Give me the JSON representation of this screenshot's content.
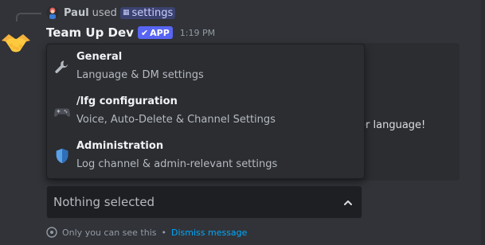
{
  "reply": {
    "user": "Paul",
    "verb": "used",
    "command": "settings"
  },
  "message": {
    "username": "Team Up Dev",
    "badge": "APP",
    "timestamp": "1:19 PM"
  },
  "embed": {
    "visible_text": "rver language!"
  },
  "dropdown": {
    "options": [
      {
        "icon": "wrench-icon",
        "label": "General",
        "description": "Language & DM settings"
      },
      {
        "icon": "gamepad-icon",
        "label": "/lfg configuration",
        "description": "Voice, Auto-Delete & Channel Settings"
      },
      {
        "icon": "shield-icon",
        "label": "Administration",
        "description": "Log channel & admin-relevant settings"
      }
    ]
  },
  "select": {
    "placeholder": "Nothing selected"
  },
  "footer": {
    "notice": "Only you can see this",
    "separator": "•",
    "dismiss": "Dismiss message"
  },
  "colors": {
    "background": "#313338",
    "embed": "#2b2d31",
    "brand": "#5865f2",
    "link": "#00a8fc"
  }
}
